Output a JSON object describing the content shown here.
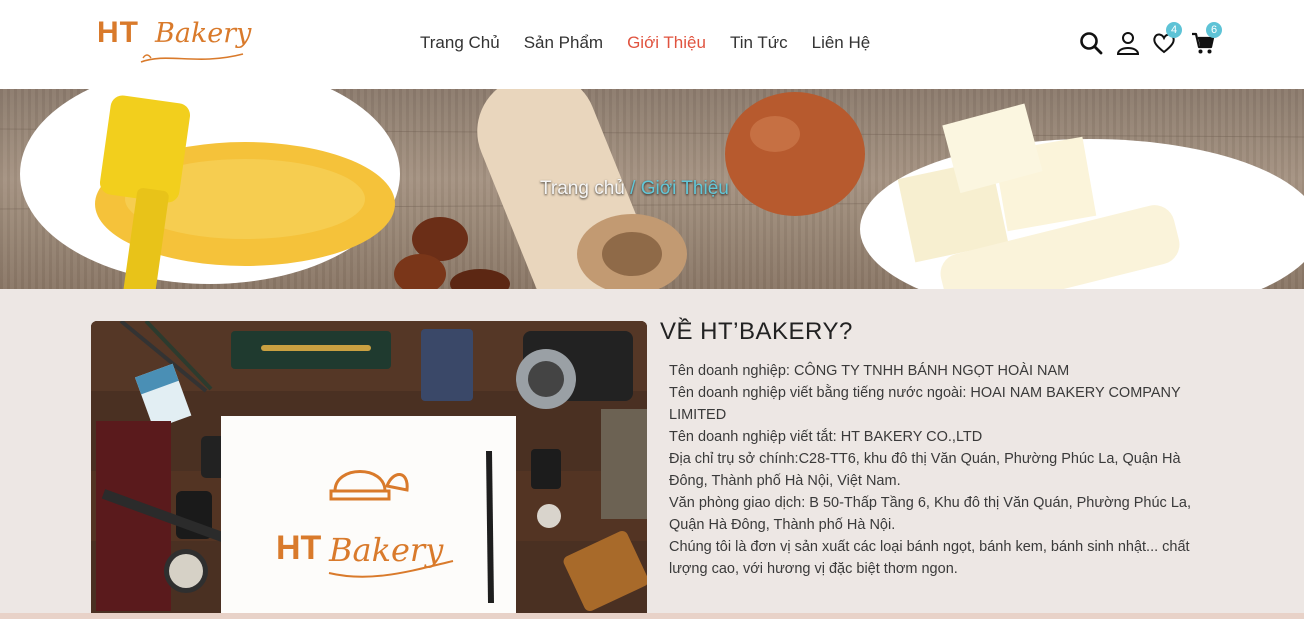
{
  "brand": {
    "name_part1": "HT",
    "name_part2": "Bakery",
    "color": "#d97a2b"
  },
  "nav": {
    "items": [
      {
        "label": "Trang Chủ",
        "active": false
      },
      {
        "label": "Sản Phẩm",
        "active": false
      },
      {
        "label": "Giới Thiệu",
        "active": true
      },
      {
        "label": "Tin Tức",
        "active": false
      },
      {
        "label": "Liên Hệ",
        "active": false
      }
    ],
    "active_color": "#e0533f"
  },
  "header_icons": {
    "search": "search-icon",
    "account": "user-icon",
    "wishlist": {
      "icon": "heart-icon",
      "count": "4"
    },
    "cart": {
      "icon": "cart-icon",
      "count": "6"
    },
    "badge_color": "#5ec3d6"
  },
  "breadcrumb": {
    "home": "Trang chủ",
    "separator": "/",
    "current": "Giới Thiệu"
  },
  "about": {
    "title": "VỀ HT’BAKERY?",
    "lines": [
      "Tên doanh nghiệp: CÔNG TY TNHH BÁNH NGỌT HOÀI NAM",
      "Tên doanh nghiệp viết bằng tiếng nước ngoài: HOAI NAM BAKERY COMPANY LIMITED",
      "Tên doanh nghiệp viết tắt: HT BAKERY CO.,LTD",
      "Địa chỉ trụ sở chính:C28-TT6, khu đô thị Văn Quán, Phường Phúc La, Quận Hà Đông, Thành phố Hà Nội, Việt Nam.",
      "Văn phòng giao dịch: B 50-Thấp Tầng 6, Khu đô thị Văn Quán, Phường Phúc La, Quận Hà Đông, Thành phố Hà Nội.",
      "Chúng tôi là đơn vị sản xuất các loại bánh ngọt, bánh kem, bánh sinh nhật... chất lượng cao, với hương vị đặc biệt thơm ngon."
    ]
  },
  "about_image": {
    "logo_part1": "HT",
    "logo_part2": "Bakery"
  }
}
